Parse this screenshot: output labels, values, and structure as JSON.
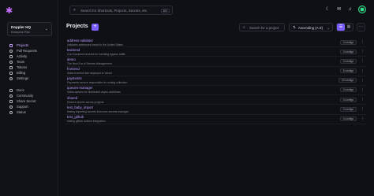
{
  "workspace": {
    "name": "Doppler HQ",
    "plan": "Enterprise Plan"
  },
  "sidebar": {
    "primary": [
      {
        "label": "Projects",
        "active": true
      },
      {
        "label": "Pull Requests"
      },
      {
        "label": "Activity"
      },
      {
        "label": "Team"
      },
      {
        "label": "Tokens"
      },
      {
        "label": "Billing"
      },
      {
        "label": "Settings"
      }
    ],
    "secondary": [
      {
        "label": "Docs"
      },
      {
        "label": "Community"
      },
      {
        "label": "Share Secret"
      },
      {
        "label": "Support"
      },
      {
        "label": "Status"
      }
    ]
  },
  "topbar": {
    "search_placeholder": "Search for Shortcuts, Projects, Secrets, etc.",
    "search_shortcut": "⌘K"
  },
  "main": {
    "title": "Projects",
    "add_label": "+",
    "search_placeholder": "Search for a project",
    "sort_value": "Ascending (A-Z)",
    "more_label": "···"
  },
  "projects": [
    {
      "name": "address-validator",
      "desc": "Validates addresses based in the United States",
      "configs": "3 configs"
    },
    {
      "name": "backend",
      "desc": "Core backend services for handling bypass traffic",
      "configs": "3 configs"
    },
    {
      "name": "demo",
      "desc": "The New Era of Secrets Management",
      "configs": "3 configs"
    },
    {
      "name": "frontend",
      "desc": "Static frontend site deployed to Vercel",
      "configs": "5 configs"
    },
    {
      "name": "payments",
      "desc": "Payments service responsible for routing collection",
      "configs": "10 configs"
    },
    {
      "name": "queues-manager",
      "desc": "Kafka queues for distributed async workflows",
      "configs": "3 configs"
    },
    {
      "name": "shared",
      "desc": "Shared secrets across projects",
      "configs": "3 configs"
    },
    {
      "name": "test_baby_import",
      "desc": "testing importing secrets from new secrets manager",
      "configs": "3 configs"
    },
    {
      "name": "test_github",
      "desc": "testing github actions integration",
      "configs": "3 configs"
    }
  ],
  "colors": {
    "accent": "#7b5cff",
    "link": "#b99cff",
    "bg": "#0f1014"
  }
}
